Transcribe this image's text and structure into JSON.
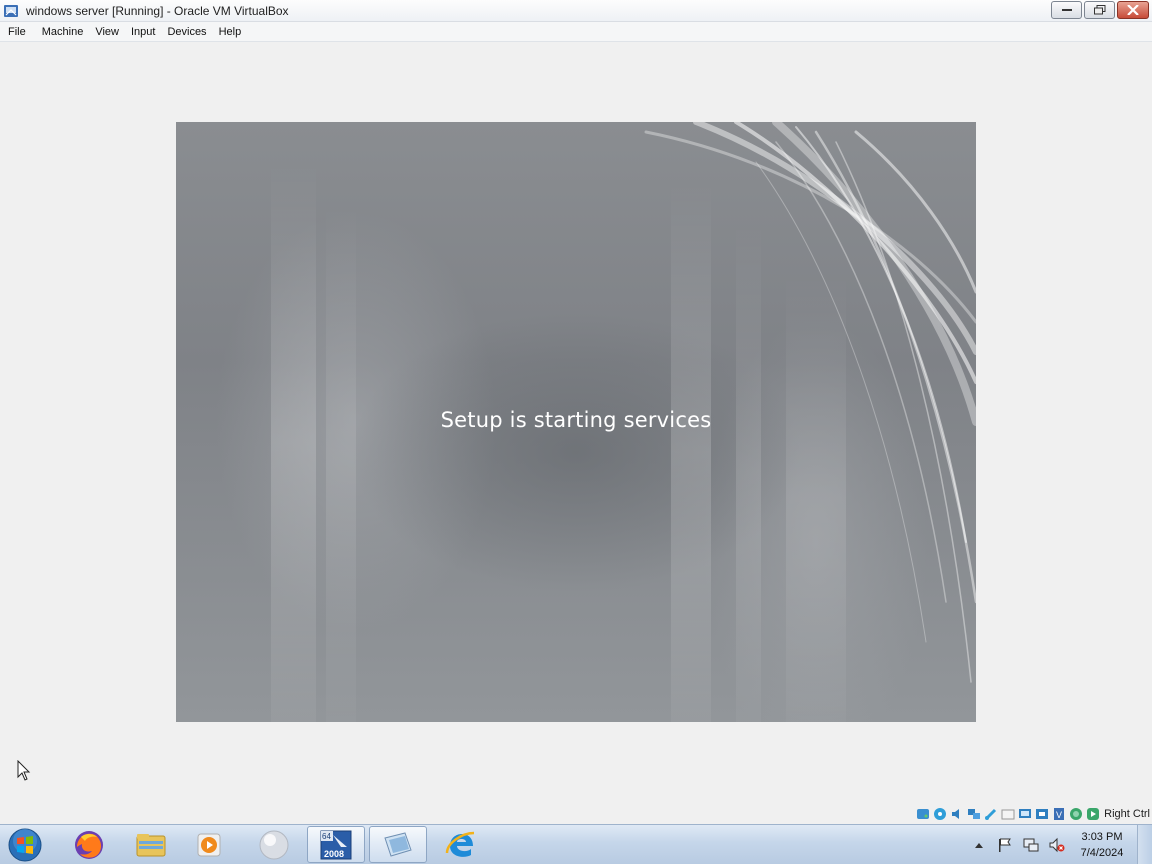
{
  "window": {
    "title": "windows server [Running] - Oracle VM VirtualBox",
    "controls": [
      "minimize",
      "restore",
      "close"
    ]
  },
  "menu": {
    "items": [
      "File",
      "Machine",
      "View",
      "Input",
      "Devices",
      "Help"
    ]
  },
  "vm": {
    "status_message": "Setup is starting services"
  },
  "status_bar": {
    "host_key": "Right Ctrl",
    "icons": [
      "hard-disk-icon",
      "optical-drive-icon",
      "audio-icon",
      "network-icon",
      "usb-icon",
      "shared-folders-icon",
      "display-icon",
      "video-capture-icon",
      "vm-icon",
      "cpu-icon",
      "mouse-integration-icon",
      "keyboard-icon"
    ]
  },
  "taskbar": {
    "pinned": [
      "firefox-icon",
      "explorer-icon",
      "media-player-icon",
      "app-orb-icon",
      "server-2008-icon",
      "virtualbox-icon",
      "internet-explorer-icon"
    ],
    "server_badge_top": "64",
    "server_badge_bottom": "2008"
  },
  "tray": {
    "time": "3:03 PM",
    "date": "7/4/2024",
    "icons": [
      "show-hidden-icon",
      "action-center-flag-icon",
      "network-tray-icon",
      "volume-muted-icon"
    ]
  }
}
